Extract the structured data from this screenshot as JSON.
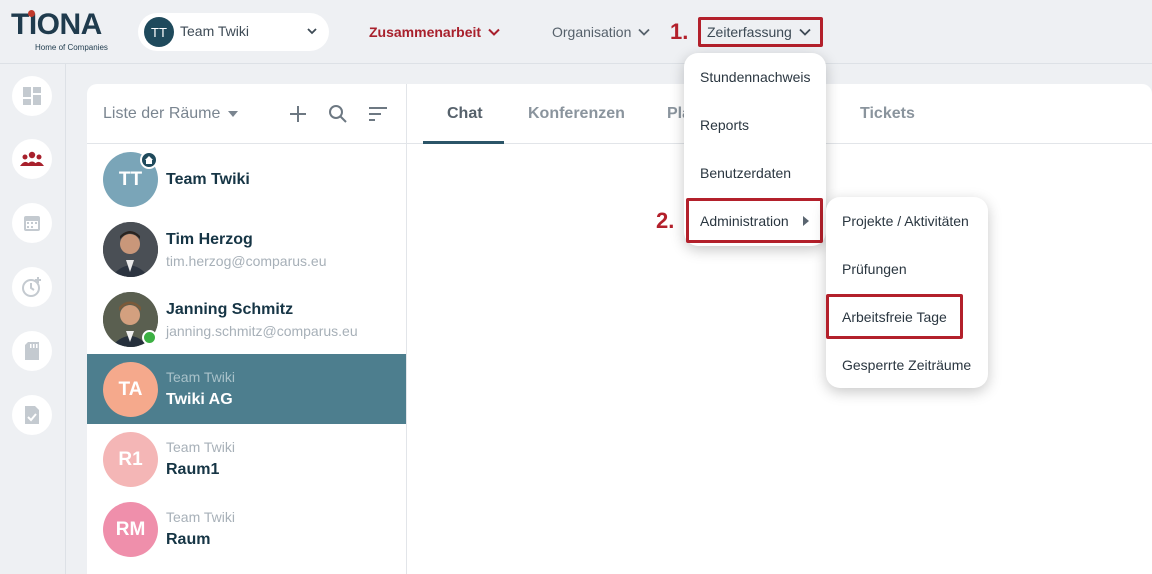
{
  "logo": {
    "word": "TIONA",
    "tagline": "Home of Companies"
  },
  "team_select": {
    "initials": "TT",
    "label": "Team Twiki"
  },
  "nav": {
    "zusammenarbeit": "Zusammenarbeit",
    "organisation": "Organisation",
    "zeiterfassung": "Zeiterfassung"
  },
  "steps": {
    "one": "1.",
    "two": "2."
  },
  "rooms": {
    "title": "Liste der Räume",
    "items": [
      {
        "initials": "TT",
        "name": "Team Twiki",
        "color": "#7aa5b8"
      },
      {
        "name": "Tim Herzog",
        "email": "tim.herzog@comparus.eu"
      },
      {
        "name": "Janning Schmitz",
        "email": "janning.schmitz@comparus.eu"
      },
      {
        "initials": "TA",
        "team": "Team Twiki",
        "name": "Twiki AG",
        "color": "#f5a98c"
      },
      {
        "initials": "R1",
        "team": "Team Twiki",
        "name": "Raum1",
        "color": "#f4b6b6"
      },
      {
        "initials": "RM",
        "team": "Team Twiki",
        "name": "Raum",
        "color": "#ef8fab"
      }
    ]
  },
  "tabs": {
    "chat": "Chat",
    "konferenzen": "Konferenzen",
    "pla": "Pla",
    "tickets": "Tickets"
  },
  "menu_zeiterfassung": {
    "items": [
      "Stundennachweis",
      "Reports",
      "Benutzerdaten",
      "Administration"
    ]
  },
  "menu_administration": {
    "items": [
      "Projekte / Aktivitäten",
      "Prüfungen",
      "Arbeitsfreie Tage",
      "Gesperrte Zeiträume"
    ]
  },
  "colors": {
    "accent_red": "#b3202b",
    "brand_dark": "#1f3b4d",
    "active_row": "#4d7e8e"
  }
}
